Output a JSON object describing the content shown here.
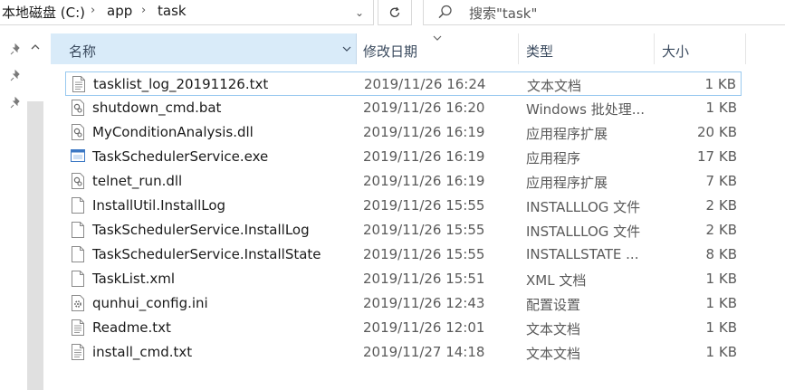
{
  "address": {
    "crumbs": [
      "本地磁盘 (C:)",
      "app",
      "task"
    ]
  },
  "search": {
    "placeholder": "搜索\"task\""
  },
  "columns": {
    "name": "名称",
    "date": "修改日期",
    "type": "类型",
    "size": "大小"
  },
  "files": [
    {
      "name": "tasklist_log_20191126.txt",
      "date": "2019/11/26 16:24",
      "type": "文本文档",
      "size": "1 KB",
      "icon": "text-file-icon",
      "selected": true
    },
    {
      "name": "shutdown_cmd.bat",
      "date": "2019/11/26 16:20",
      "type": "Windows 批处理...",
      "size": "1 KB",
      "icon": "batch-file-icon"
    },
    {
      "name": "MyConditionAnalysis.dll",
      "date": "2019/11/26 16:19",
      "type": "应用程序扩展",
      "size": "20 KB",
      "icon": "dll-file-icon"
    },
    {
      "name": "TaskSchedulerService.exe",
      "date": "2019/11/26 16:19",
      "type": "应用程序",
      "size": "17 KB",
      "icon": "exe-file-icon"
    },
    {
      "name": "telnet_run.dll",
      "date": "2019/11/26 16:19",
      "type": "应用程序扩展",
      "size": "7 KB",
      "icon": "dll-file-icon"
    },
    {
      "name": "InstallUtil.InstallLog",
      "date": "2019/11/26 15:55",
      "type": "INSTALLLOG 文件",
      "size": "2 KB",
      "icon": "blank-file-icon"
    },
    {
      "name": "TaskSchedulerService.InstallLog",
      "date": "2019/11/26 15:55",
      "type": "INSTALLLOG 文件",
      "size": "2 KB",
      "icon": "blank-file-icon"
    },
    {
      "name": "TaskSchedulerService.InstallState",
      "date": "2019/11/26 15:55",
      "type": "INSTALLSTATE ...",
      "size": "8 KB",
      "icon": "blank-file-icon"
    },
    {
      "name": "TaskList.xml",
      "date": "2019/11/26 15:51",
      "type": "XML 文档",
      "size": "1 KB",
      "icon": "blank-file-icon"
    },
    {
      "name": "qunhui_config.ini",
      "date": "2019/11/26 12:43",
      "type": "配置设置",
      "size": "1 KB",
      "icon": "config-file-icon"
    },
    {
      "name": "Readme.txt",
      "date": "2019/11/26 12:01",
      "type": "文本文档",
      "size": "1 KB",
      "icon": "text-file-icon"
    },
    {
      "name": "install_cmd.txt",
      "date": "2019/11/27 14:18",
      "type": "文本文档",
      "size": "1 KB",
      "icon": "text-file-icon"
    }
  ]
}
